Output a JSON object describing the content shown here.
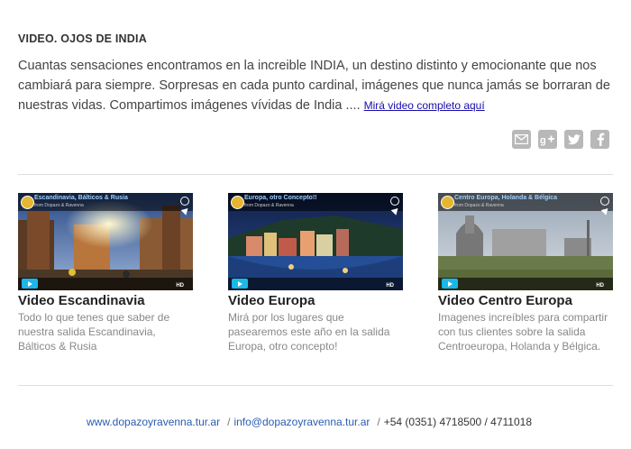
{
  "article": {
    "title": "VIDEO. OJOS DE INDIA",
    "intro": "Cuantas sensaciones encontramos en la increible INDIA, un destino distinto y emocionante que nos cambiará para siempre. Sorpresas en cada punto cardinal, imágenes que nunca jamás se borraran de nuestras vidas. Compartimos imágenes vívidas de India .... ",
    "link_label": "Mirá video completo aquí"
  },
  "social": [
    "email-icon",
    "google-plus-icon",
    "twitter-icon",
    "facebook-icon"
  ],
  "videos": [
    {
      "player_title": "Escandinavia, Bálticos & Rusia",
      "player_from": "from Dopazo & Ravenna",
      "hd": "HD",
      "title": "Video Escandinavia",
      "description": "Todo lo que tenes que saber de nuestra salida Escandinavia, Bálticos & Rusia"
    },
    {
      "player_title": "Europa, otro Concepto!!",
      "player_from": "from Dopazo & Ravenna",
      "hd": "HD",
      "title": "Video Europa",
      "description": "Mirá por los lugares que pasearemos este año en la salida Europa, otro concepto!"
    },
    {
      "player_title": "Centro Europa, Holanda & Bélgica",
      "player_from": "from Dopazo & Ravenna",
      "hd": "HD",
      "title": "Video Centro Europa",
      "description": "Imagenes increíbles para compartir con tus clientes sobre la salida Centroeuropa, Holanda y Bélgica."
    }
  ],
  "footer": {
    "website": "www.dopazoyravenna.tur.ar",
    "email": "info@dopazoyravenna.tur.ar",
    "phone": "+54 (0351) 4718500 / 4711018",
    "separator": "/"
  }
}
